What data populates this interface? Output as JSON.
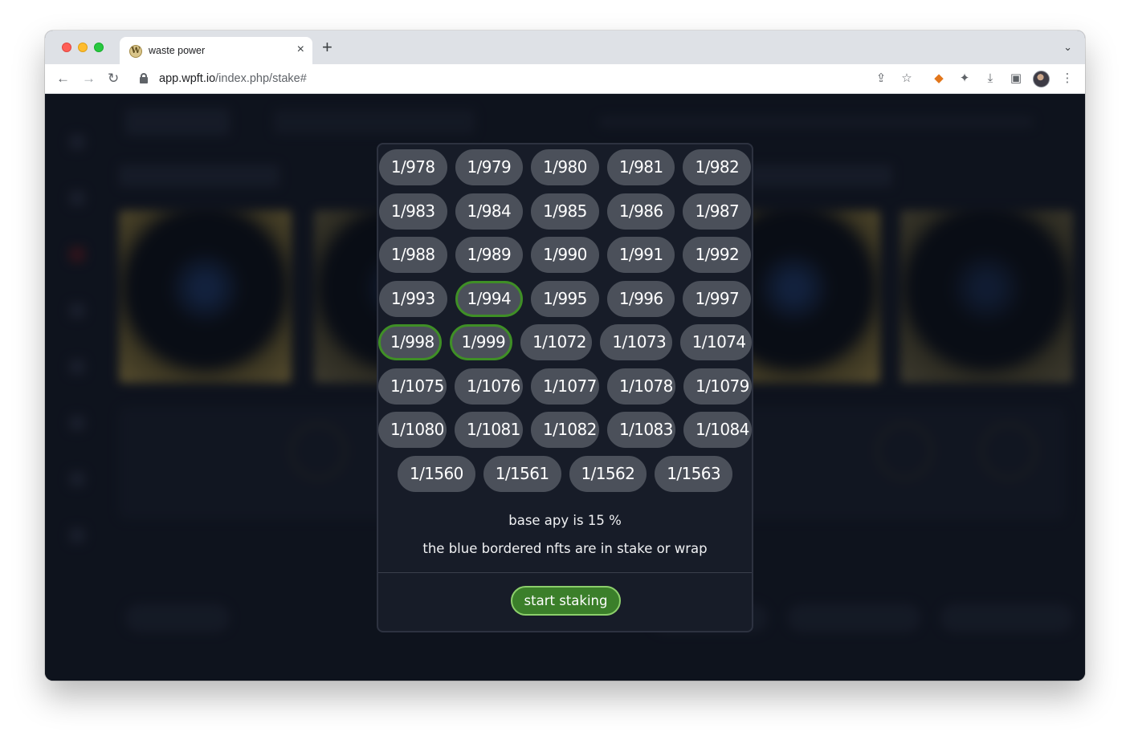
{
  "browser": {
    "tab_title": "waste power",
    "favicon_letter": "W",
    "url_host": "app.wpft.io",
    "url_path": "/index.php/stake#",
    "new_tab": "+",
    "close_tab": "×",
    "tab_menu": "⌄"
  },
  "modal": {
    "rows": [
      [
        "1/978",
        "1/979",
        "1/980",
        "1/981",
        "1/982"
      ],
      [
        "1/983",
        "1/984",
        "1/985",
        "1/986",
        "1/987"
      ],
      [
        "1/988",
        "1/989",
        "1/990",
        "1/991",
        "1/992"
      ],
      [
        "1/993",
        "1/994",
        "1/995",
        "1/996",
        "1/997"
      ],
      [
        "1/998",
        "1/999",
        "1/1072",
        "1/1073",
        "1/1074"
      ],
      [
        "1/1075",
        "1/1076",
        "1/1077",
        "1/1078",
        "1/1079"
      ],
      [
        "1/1080",
        "1/1081",
        "1/1082",
        "1/1083",
        "1/1084"
      ],
      [
        "1/1560",
        "1/1561",
        "1/1562",
        "1/1563"
      ]
    ],
    "selected": [
      "1/994",
      "1/998",
      "1/999"
    ],
    "apy_text": "base apy is 15 %",
    "note_text": "the blue bordered nfts are in stake or wrap",
    "start_button": "start staking"
  },
  "colors": {
    "selected_border": "#3f8f26",
    "start_button_bg": "#3b7f2a",
    "pill_bg": "#4b505a"
  }
}
